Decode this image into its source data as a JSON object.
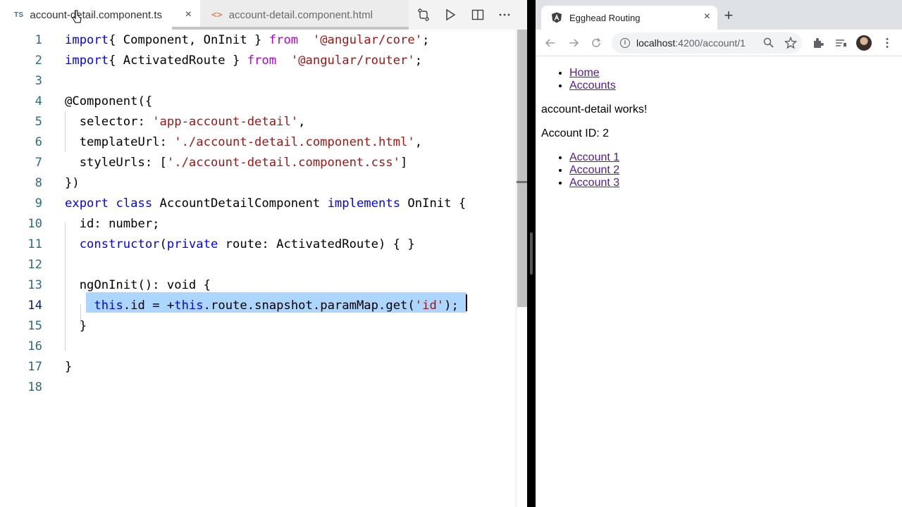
{
  "editor": {
    "tabs": [
      {
        "badge": "TS",
        "label": "account-detail.component.ts",
        "active": true
      },
      {
        "badge": "<>",
        "label": "account-detail.component.html",
        "active": false
      }
    ],
    "close_glyph": "×",
    "toolbar": [
      "compare-changes-icon",
      "run-icon",
      "split-editor-icon",
      "more-actions-icon"
    ],
    "current_line": 14,
    "lines": [
      {
        "n": "1",
        "tokens": [
          [
            "kw",
            "import"
          ],
          [
            "",
            "{ Component, OnInit } "
          ],
          [
            "ctl",
            "from"
          ],
          [
            "",
            "  "
          ],
          [
            "str",
            "'@angular/core'"
          ],
          [
            "",
            ";"
          ]
        ]
      },
      {
        "n": "2",
        "tokens": [
          [
            "kw",
            "import"
          ],
          [
            "",
            "{ ActivatedRoute } "
          ],
          [
            "ctl",
            "from"
          ],
          [
            "",
            "  "
          ],
          [
            "str",
            "'@angular/router'"
          ],
          [
            "",
            ";"
          ]
        ]
      },
      {
        "n": "3",
        "tokens": []
      },
      {
        "n": "4",
        "tokens": [
          [
            "",
            "@Component({"
          ]
        ]
      },
      {
        "n": "5",
        "tokens": [
          [
            "",
            "  selector: "
          ],
          [
            "str",
            "'app-account-detail'"
          ],
          [
            "",
            ","
          ]
        ]
      },
      {
        "n": "6",
        "tokens": [
          [
            "",
            "  templateUrl: "
          ],
          [
            "str",
            "'./account-detail.component.html'"
          ],
          [
            "",
            ","
          ]
        ]
      },
      {
        "n": "7",
        "tokens": [
          [
            "",
            "  styleUrls: ["
          ],
          [
            "str",
            "'./account-detail.component.css'"
          ],
          [
            "",
            "]"
          ]
        ]
      },
      {
        "n": "8",
        "tokens": [
          [
            "",
            "})"
          ]
        ]
      },
      {
        "n": "9",
        "tokens": [
          [
            "kw",
            "export"
          ],
          [
            "",
            " "
          ],
          [
            "kw",
            "class"
          ],
          [
            "",
            " AccountDetailComponent "
          ],
          [
            "kw",
            "implements"
          ],
          [
            "",
            " OnInit {"
          ]
        ]
      },
      {
        "n": "10",
        "tokens": [
          [
            "",
            "  id: number;"
          ]
        ]
      },
      {
        "n": "11",
        "tokens": [
          [
            "",
            "  "
          ],
          [
            "kw",
            "constructor"
          ],
          [
            "",
            "("
          ],
          [
            "kw",
            "private"
          ],
          [
            "",
            " route: ActivatedRoute) { }"
          ]
        ]
      },
      {
        "n": "12",
        "tokens": []
      },
      {
        "n": "13",
        "tokens": [
          [
            "",
            "  ngOnInit(): void {"
          ]
        ]
      },
      {
        "n": "14",
        "tokens": [
          [
            "",
            "    "
          ],
          [
            "kw",
            "this"
          ],
          [
            "",
            ".id = +"
          ],
          [
            "kw",
            "this"
          ],
          [
            "",
            ".route.snapshot.paramMap.get("
          ],
          [
            "str",
            "'id'"
          ],
          [
            "",
            ");"
          ]
        ]
      },
      {
        "n": "15",
        "tokens": [
          [
            "",
            "  }"
          ]
        ]
      },
      {
        "n": "16",
        "tokens": []
      },
      {
        "n": "17",
        "tokens": [
          [
            "",
            "}"
          ]
        ]
      },
      {
        "n": "18",
        "tokens": []
      }
    ]
  },
  "browser": {
    "tab_title": "Egghead Routing",
    "tab_close": "×",
    "new_tab": "+",
    "url_host": "localhost",
    "url_path": ":4200/account/1",
    "info_glyph": "i",
    "page": {
      "nav_links": [
        "Home",
        "Accounts"
      ],
      "heading": "account-detail works!",
      "account_id_text": "Account ID: 2",
      "account_links": [
        "Account 1",
        "Account 2",
        "Account 3"
      ]
    }
  },
  "colors": {
    "keyword": "#0000ff",
    "string": "#a31515",
    "control": "#af00db",
    "selection": "#add6ff",
    "link": "#551a8b"
  }
}
